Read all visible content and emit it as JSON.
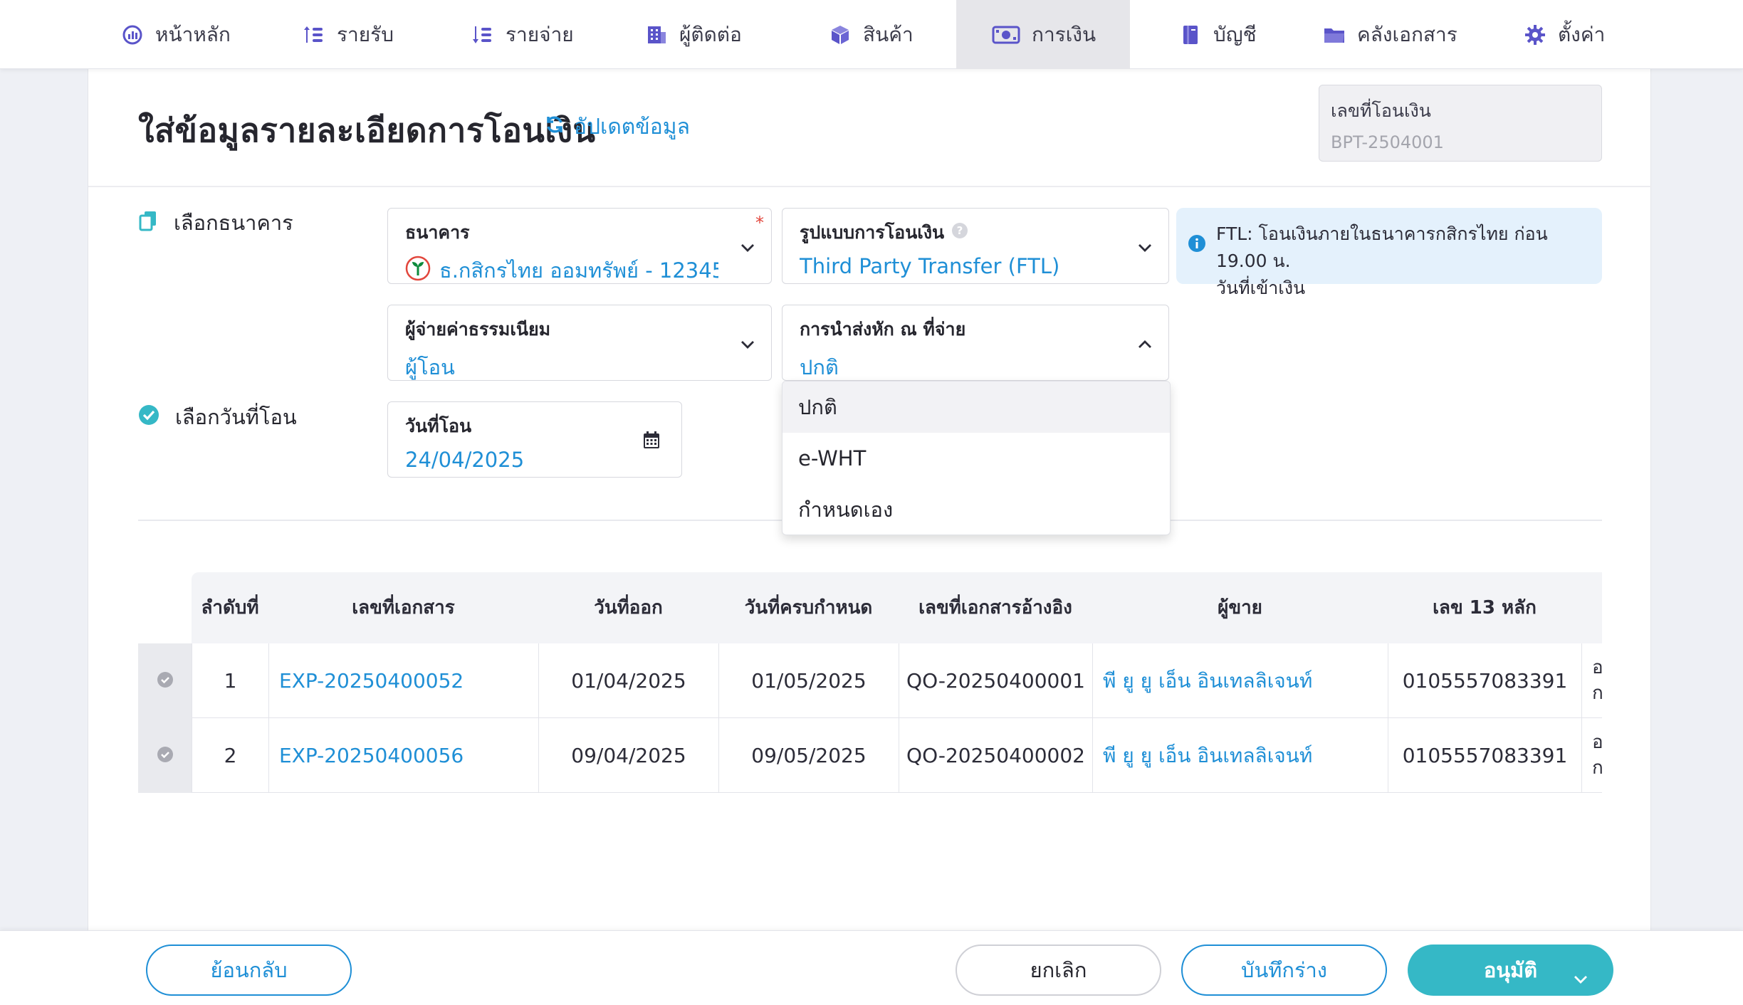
{
  "nav": {
    "items": [
      {
        "label": "หน้าหลัก",
        "icon": "dashboard-icon"
      },
      {
        "label": "รายรับ",
        "icon": "income-list-icon"
      },
      {
        "label": "รายจ่าย",
        "icon": "expense-list-icon"
      },
      {
        "label": "ผู้ติดต่อ",
        "icon": "contacts-building-icon"
      },
      {
        "label": "สินค้า",
        "icon": "product-box-icon"
      },
      {
        "label": "การเงิน",
        "icon": "finance-money-icon",
        "active": true
      },
      {
        "label": "บัญชี",
        "icon": "ledger-book-icon"
      },
      {
        "label": "คลังเอกสาร",
        "icon": "folder-icon"
      },
      {
        "label": "ตั้งค่า",
        "icon": "gear-icon"
      }
    ]
  },
  "header": {
    "title": "ใส่ข้อมูลรายละเอียดการโอนเงิน",
    "refresh_label": "อัปเดตข้อมูล",
    "doc_number_label": "เลขที่โอนเงิน",
    "doc_number_value": "BPT-2504001"
  },
  "sections": {
    "bank_label": "เลือกธนาคาร",
    "date_label": "เลือกวันที่โอน"
  },
  "form": {
    "bank": {
      "label": "ธนาคาร",
      "value": "ธ.กสิกรไทย ออมทรัพย์ - 12345...",
      "required_mark": "*"
    },
    "transfer_type": {
      "label": "รูปแบบการโอนเงิน",
      "value": "Third Party Transfer (FTL)"
    },
    "fee_payer": {
      "label": "ผู้จ่ายค่าธรรมเนียม",
      "value": "ผู้โอน"
    },
    "withholding": {
      "label": "การนำส่งหัก ณ ที่จ่าย",
      "value": "ปกติ"
    },
    "transfer_date": {
      "label": "วันที่โอน",
      "value": "24/04/2025"
    }
  },
  "info": {
    "line1": "FTL: โอนเงินภายในธนาคารกสิกรไทย ก่อน 19.00 น.",
    "line2": "วันที่เข้าเงิน"
  },
  "dropdown": {
    "options": [
      "ปกติ",
      "e-WHT",
      "กำหนดเอง"
    ],
    "selected": "ปกติ"
  },
  "table": {
    "headers": [
      "ลำดับที่",
      "เลขที่เอกสาร",
      "วันที่ออก",
      "วันที่ครบกำหนด",
      "เลขที่เอกสารอ้างอิง",
      "ผู้ขาย",
      "เลข 13 หลัก"
    ],
    "rows": [
      {
        "no": "1",
        "doc": "EXP-20250400052",
        "issued": "01/04/2025",
        "due": "01/05/2025",
        "ref": "QO-20250400001",
        "vendor": "พี ยู ยู เอ็น อินเทลลิเจนท์",
        "tax_id": "0105557083391",
        "extra1": "อ",
        "extra2": "ก"
      },
      {
        "no": "2",
        "doc": "EXP-20250400056",
        "issued": "09/04/2025",
        "due": "09/05/2025",
        "ref": "QO-20250400002",
        "vendor": "พี ยู ยู เอ็น อินเทลลิเจนท์",
        "tax_id": "0105557083391",
        "extra1": "อ",
        "extra2": "ก"
      }
    ]
  },
  "footer": {
    "back_label": "ย้อนกลับ",
    "cancel_label": "ยกเลิก",
    "draft_label": "บันทึกร่าง",
    "approve_label": "อนุมัติ"
  },
  "colors": {
    "accent_blue": "#1f8fd6",
    "primary_teal": "#35b8c6",
    "nav_icon": "#5a54c9",
    "required_red": "#e2463c",
    "info_bg": "#e4f1fc"
  }
}
